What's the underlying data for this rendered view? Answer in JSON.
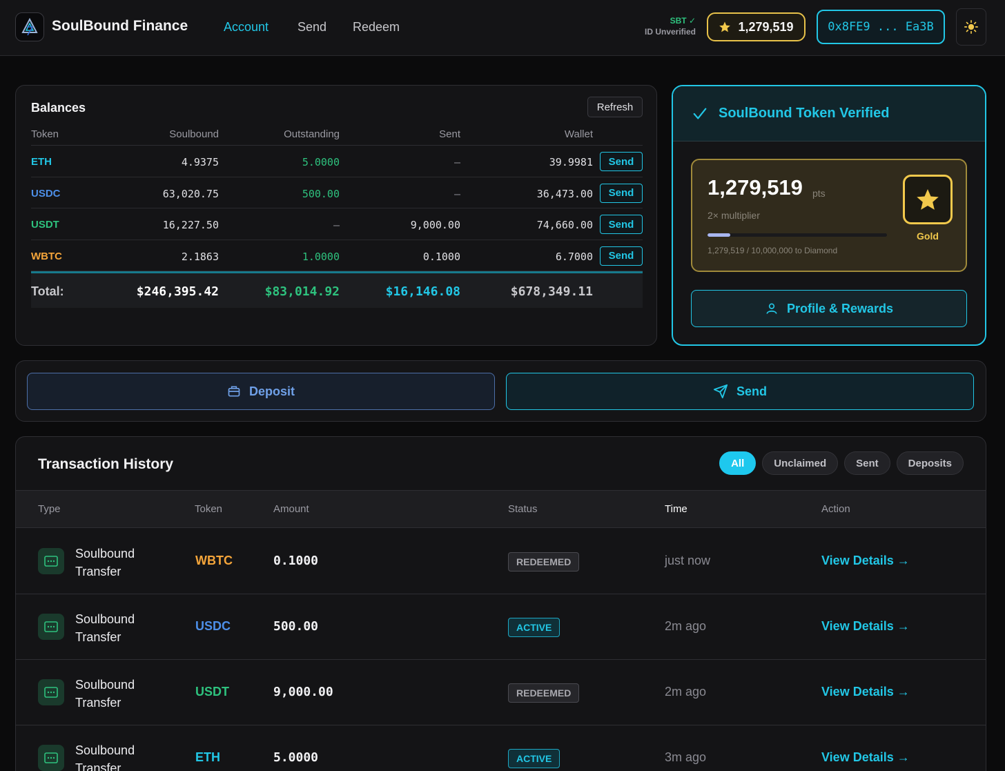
{
  "header": {
    "app_title": "SoulBound Finance",
    "nav": [
      "Account",
      "Send",
      "Redeem"
    ],
    "sbt_status": "SBT ✓",
    "id_status": "ID Unverified",
    "points": "1,279,519",
    "wallet": "0x8FE9 ... Ea3B"
  },
  "balances": {
    "title": "Balances",
    "refresh": "Refresh",
    "columns": [
      "Token",
      "Soulbound",
      "Outstanding",
      "Sent",
      "Wallet"
    ],
    "rows": [
      {
        "token": "ETH",
        "soulbound": "4.9375",
        "outstanding": "5.0000",
        "sent": "–",
        "wallet": "39.9981",
        "action": "Send",
        "color": "#22c7e6"
      },
      {
        "token": "USDC",
        "soulbound": "63,020.75",
        "outstanding": "500.00",
        "sent": "–",
        "wallet": "36,473.00",
        "action": "Send",
        "color": "#4d8fe8"
      },
      {
        "token": "USDT",
        "soulbound": "16,227.50",
        "outstanding": "–",
        "sent": "9,000.00",
        "wallet": "74,660.00",
        "action": "Send",
        "color": "#2ec27e"
      },
      {
        "token": "WBTC",
        "soulbound": "2.1863",
        "outstanding": "1.0000",
        "sent": "0.1000",
        "wallet": "6.7000",
        "action": "Send",
        "color": "#f5a53a"
      }
    ],
    "total": {
      "label": "Total:",
      "soulbound": "$246,395.42",
      "outstanding": "$83,014.92",
      "sent": "$16,146.08",
      "wallet": "$678,349.11"
    }
  },
  "verified": {
    "title": "SoulBound Token Verified",
    "points": "1,279,519",
    "points_unit": "pts",
    "multiplier": "2× multiplier",
    "progress_text": "1,279,519 / 10,000,000 to Diamond",
    "progress_fraction": 0.128,
    "tier": "Gold",
    "profile_button": "Profile & Rewards"
  },
  "actions": {
    "deposit": "Deposit",
    "send": "Send"
  },
  "transactions": {
    "title": "Transaction History",
    "filters": [
      "All",
      "Unclaimed",
      "Sent",
      "Deposits"
    ],
    "columns": [
      "Type",
      "Token",
      "Amount",
      "Status",
      "Time",
      "Action"
    ],
    "rows": [
      {
        "type": "Soulbound Transfer",
        "token": "WBTC",
        "amount": "0.1000",
        "status": "REDEEMED",
        "time": "just now",
        "action": "View Details →",
        "color": "#f5a53a"
      },
      {
        "type": "Soulbound Transfer",
        "token": "USDC",
        "amount": "500.00",
        "status": "ACTIVE",
        "time": "2m ago",
        "action": "View Details →",
        "color": "#4d8fe8"
      },
      {
        "type": "Soulbound Transfer",
        "token": "USDT",
        "amount": "9,000.00",
        "status": "REDEEMED",
        "time": "2m ago",
        "action": "View Details →",
        "color": "#2ec27e"
      },
      {
        "type": "Soulbound Transfer",
        "token": "ETH",
        "amount": "5.0000",
        "status": "ACTIVE",
        "time": "3m ago",
        "action": "View Details →",
        "color": "#22c7e6"
      }
    ]
  }
}
